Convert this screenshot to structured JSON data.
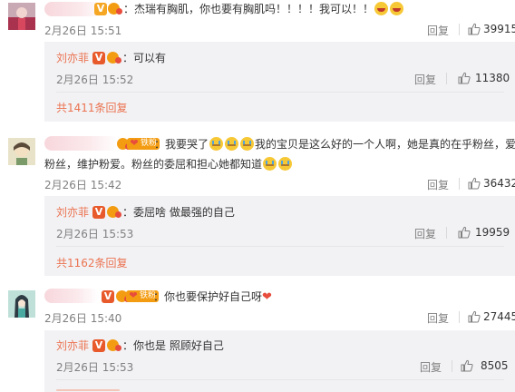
{
  "comments": [
    {
      "text": "：杰瑞有胸肌，你也要有胸肌吗！！！！我可以！！",
      "emojis": [
        "smile-emoji",
        "smile-emoji"
      ],
      "date": "2月26日 15:51",
      "reply_label": "回复",
      "likes": "39915",
      "sub_reply": {
        "author": "刘亦菲",
        "text": "：可以有",
        "date": "2月26日 15:52",
        "reply_label": "回复",
        "likes": "11380"
      },
      "more_replies": "共1411条回复"
    },
    {
      "fan_badge": "铁粉",
      "text_a": "：我要哭了",
      "text_b": "我的宝贝是这么好的一个人啊，她是真的在乎粉丝，爱",
      "text_line2": "粉丝，维护粉爱。粉丝的委屈和担心她都知道",
      "emojis": [
        "cry-emoji",
        "cry-emoji",
        "cry-emoji",
        "cry-emoji",
        "cry-emoji"
      ],
      "date": "2月26日 15:42",
      "reply_label": "回复",
      "likes": "36432",
      "sub_reply": {
        "author": "刘亦菲",
        "text": "：委屈啥 做最强的自己",
        "date": "2月26日 15:53",
        "reply_label": "回复",
        "likes": "19959"
      },
      "more_replies": "共1162条回复"
    },
    {
      "fan_badge": "铁粉",
      "text": "：你也要保护好自己呀",
      "emojis": [
        "heart-emoji"
      ],
      "date": "2月26日 15:40",
      "reply_label": "回复",
      "likes": "27445",
      "sub_reply": {
        "author": "刘亦菲",
        "text": "：你也是 照顾好自己",
        "date": "2月26日 15:53",
        "reply_label": "回复",
        "likes": "8505"
      }
    }
  ],
  "badges": {
    "verified_letter": "V"
  },
  "colors": {
    "accent": "#eb7350",
    "sub_bg": "#f2f2f5",
    "muted": "#808080"
  }
}
